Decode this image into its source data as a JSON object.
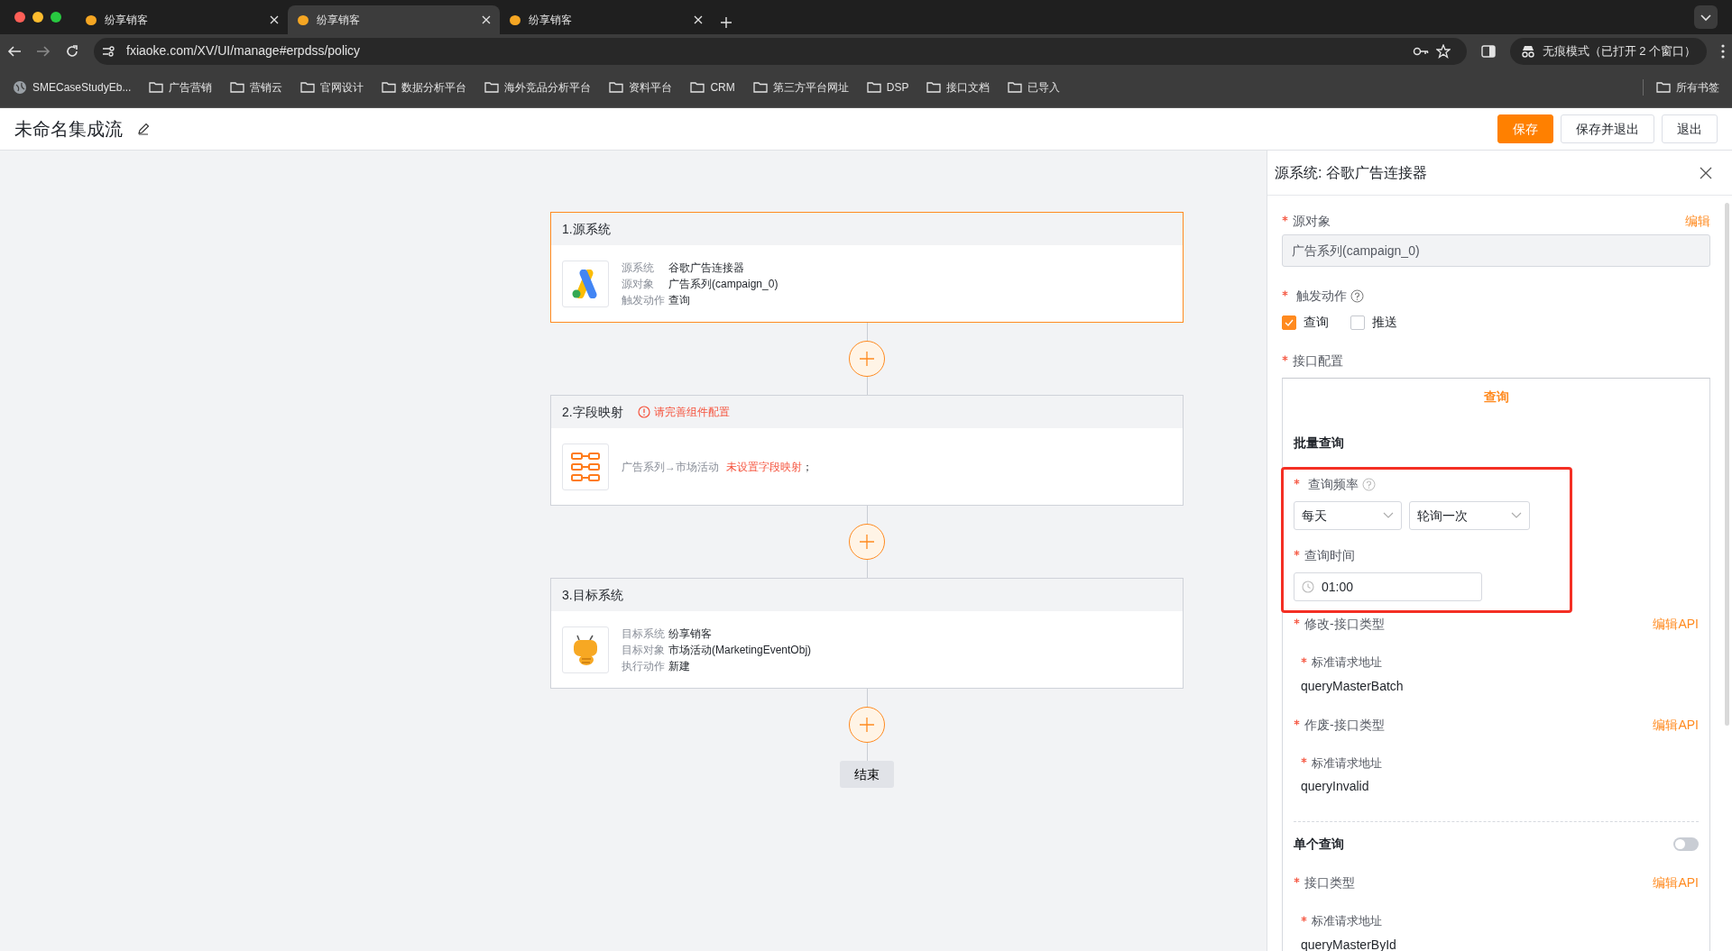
{
  "browser": {
    "tabs": [
      {
        "title": "纷享销客",
        "selected": false
      },
      {
        "title": "纷享销客",
        "selected": true
      },
      {
        "title": "纷享销客",
        "selected": false
      }
    ],
    "address": "fxiaoke.com/XV/UI/manage#erpdss/policy",
    "incognito": "无痕模式（已打开 2 个窗口）",
    "bookmarks": [
      {
        "label": "SMECaseStudyEb...",
        "kind": "site"
      },
      {
        "label": "广告营销",
        "kind": "folder"
      },
      {
        "label": "营销云",
        "kind": "folder"
      },
      {
        "label": "官网设计",
        "kind": "folder"
      },
      {
        "label": "数据分析平台",
        "kind": "folder"
      },
      {
        "label": "海外竞品分析平台",
        "kind": "folder"
      },
      {
        "label": "资料平台",
        "kind": "folder"
      },
      {
        "label": "CRM",
        "kind": "folder"
      },
      {
        "label": "第三方平台网址",
        "kind": "folder"
      },
      {
        "label": "DSP",
        "kind": "folder"
      },
      {
        "label": "接口文档",
        "kind": "folder"
      },
      {
        "label": "已导入",
        "kind": "folder"
      }
    ],
    "all_bookmarks": "所有书签"
  },
  "header": {
    "title": "未命名集成流",
    "buttons": [
      {
        "label": "保存",
        "kind": "primary"
      },
      {
        "label": "保存并退出",
        "kind": "default"
      },
      {
        "label": "退出",
        "kind": "default"
      }
    ]
  },
  "flow": {
    "nodes": [
      {
        "title": "1.源系统",
        "selected": true,
        "kind": "source",
        "rows": [
          {
            "label": "源系统",
            "value": "谷歌广告连接器"
          },
          {
            "label": "源对象",
            "value": "广告系列(campaign_0)"
          },
          {
            "label": "触发动作",
            "value": "查询"
          }
        ]
      },
      {
        "title": "2.字段映射",
        "selected": false,
        "warning": "请完善组件配置",
        "kind": "mapping",
        "summary": {
          "mapping": "广告系列→市场活动",
          "error": "未设置字段映射",
          "suffix": "；"
        }
      },
      {
        "title": "3.目标系统",
        "selected": false,
        "kind": "target",
        "rows": [
          {
            "label": "目标系统",
            "value": "纷享销客"
          },
          {
            "label": "目标对象",
            "value": "市场活动(MarketingEventObj)"
          },
          {
            "label": "执行动作",
            "value": "新建"
          }
        ]
      }
    ],
    "end_label": "结束"
  },
  "panel": {
    "title": "源系统: 谷歌广告连接器",
    "source_object": {
      "label": "源对象",
      "action": "编辑",
      "value": "广告系列(campaign_0)"
    },
    "trigger": {
      "label": "触发动作",
      "options": [
        {
          "label": "查询",
          "checked": true
        },
        {
          "label": "推送",
          "checked": false
        }
      ]
    },
    "interface": {
      "label": "接口配置",
      "tabs": [
        {
          "label": "查询",
          "selected": true
        }
      ],
      "batch": {
        "title": "批量查询",
        "frequency": {
          "label": "查询频率",
          "selects": [
            "每天",
            "轮询一次"
          ]
        },
        "time": {
          "label": "查询时间",
          "value": "01:00"
        },
        "apis": [
          {
            "label": "修改-接口类型",
            "action": "编辑API",
            "field_label": "标准请求地址",
            "value": "queryMasterBatch"
          },
          {
            "label": "作废-接口类型",
            "action": "编辑API",
            "field_label": "标准请求地址",
            "value": "queryInvalid"
          }
        ]
      },
      "single": {
        "title": "单个查询",
        "on": false,
        "apis": [
          {
            "label": "接口类型",
            "action": "编辑API",
            "field_label": "标准请求地址",
            "value": "queryMasterById"
          }
        ]
      }
    }
  }
}
